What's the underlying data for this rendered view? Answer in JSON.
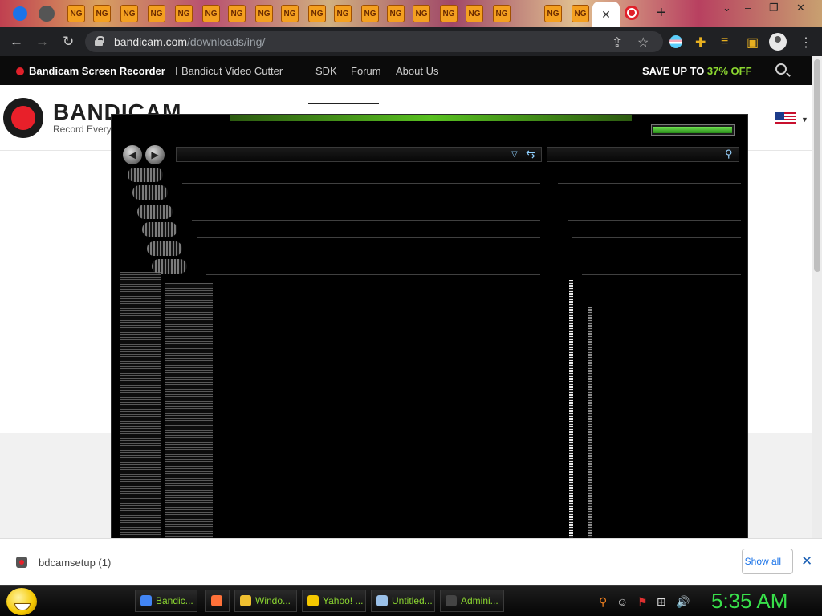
{
  "browser": {
    "url_host": "bandicam.com",
    "url_path": "/downloads/ing/",
    "tabs": {
      "background_favicon": "newgrounds-icon",
      "background_label": "NG",
      "active_close": "✕",
      "new_tab": "+"
    }
  },
  "site": {
    "nav": {
      "screen_recorder": "Bandicam Screen Recorder",
      "video_cutter": "Bandicut Video Cutter",
      "sdk": "SDK",
      "forum": "Forum",
      "about": "About Us",
      "save_prefix": "SAVE UP TO ",
      "save_pct": "37% OFF"
    },
    "brand": {
      "name": "BANDICAM",
      "tagline": "Record Every"
    }
  },
  "downloads": {
    "filename": "bdcamsetup (1)",
    "show_all": "Show all",
    "close": "✕"
  },
  "glitch_window": {
    "progress": 1.0
  },
  "taskbar": {
    "items": [
      {
        "label": "Bandic...",
        "icon": "chrome-icon",
        "color": "#4285f4"
      },
      {
        "label": "",
        "icon": "firefox-icon",
        "color": "#ff7139"
      },
      {
        "label": "Windo...",
        "icon": "folder-icon",
        "color": "#f0c030"
      },
      {
        "label": "Yahoo! ...",
        "icon": "yahoo-messenger-icon",
        "color": "#f5c800"
      },
      {
        "label": "Untitled...",
        "icon": "notepad-icon",
        "color": "#9ac0e8"
      },
      {
        "label": "Admini...",
        "icon": "command-prompt-icon",
        "color": "#444444"
      }
    ],
    "clock": "5:35 AM"
  },
  "colors": {
    "accent_red": "#e0202a",
    "promo_green": "#8bd630",
    "clock_green": "#38e04a"
  }
}
